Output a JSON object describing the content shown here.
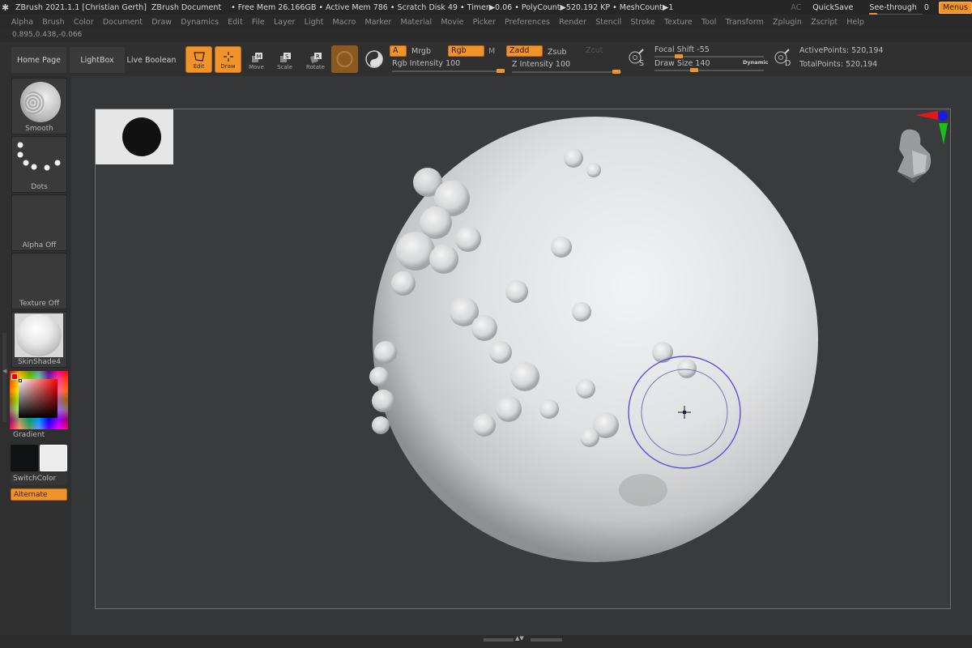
{
  "titlebar": {
    "app_title": "ZBrush 2021.1.1 [Christian Gerth]",
    "document": "ZBrush Document",
    "stats": "• Free Mem 26.166GB • Active Mem 786 • Scratch Disk 49 • Timer▶0.06 • PolyCount▶520.192 KP • MeshCount▶1",
    "ac_label": "AC",
    "quicksave_label": "QuickSave",
    "seethrough_label": "See-through",
    "seethrough_value": "0",
    "seethrough_fraction": 0,
    "menus_label": "Menus"
  },
  "menubar": {
    "items": [
      "Alpha",
      "Brush",
      "Color",
      "Document",
      "Draw",
      "Dynamics",
      "Edit",
      "File",
      "Layer",
      "Light",
      "Macro",
      "Marker",
      "Material",
      "Movie",
      "Picker",
      "Preferences",
      "Render",
      "Stencil",
      "Stroke",
      "Texture",
      "Tool",
      "Transform",
      "Zplugin",
      "Zscript",
      "Help"
    ]
  },
  "coords_readout": "0.895,0.438,-0.066",
  "shelf": {
    "home_page": "Home Page",
    "lightbox": "LightBox",
    "live_boolean": "Live Boolean",
    "tools": [
      {
        "label": "Edit",
        "active": true,
        "icon": "edit-icon"
      },
      {
        "label": "Draw",
        "active": true,
        "icon": "draw-icon"
      },
      {
        "label": "Move",
        "active": false,
        "icon": "move-icon"
      },
      {
        "label": "Scale",
        "active": false,
        "icon": "scale-icon"
      },
      {
        "label": "Rotate",
        "active": false,
        "icon": "rotate-icon"
      }
    ],
    "a_label": "A",
    "mrgb_label": "Mrgb",
    "rgb_label": "Rgb",
    "m_label": "M",
    "zadd_label": "Zadd",
    "zsub_label": "Zsub",
    "zcut_label": "Zcut",
    "rgb_intensity_label": "Rgb Intensity",
    "rgb_intensity_value": "100",
    "z_intensity_label": "Z Intensity",
    "z_intensity_value": "100",
    "focal_shift_label": "Focal Shift",
    "focal_shift_value": "-55",
    "draw_size_label": "Draw Size",
    "draw_size_value": "140",
    "dynamic_label": "Dynamic",
    "s_label": "S",
    "d_label": "D",
    "active_points": "ActivePoints: 520,194",
    "total_points": "TotalPoints: 520,194"
  },
  "lefttray": {
    "brush_label": "Smooth",
    "stroke_label": "Dots",
    "alpha_label": "Alpha Off",
    "texture_label": "Texture Off",
    "material_label": "SkinShade4",
    "gradient_label": "Gradient",
    "switchcolor_label": "SwitchColor",
    "alternate_label": "Alternate",
    "primary_color": "#111213",
    "secondary_color": "#ececec"
  },
  "colors": {
    "accent": "#f0932b",
    "brush_ring": "#5b52d8"
  }
}
